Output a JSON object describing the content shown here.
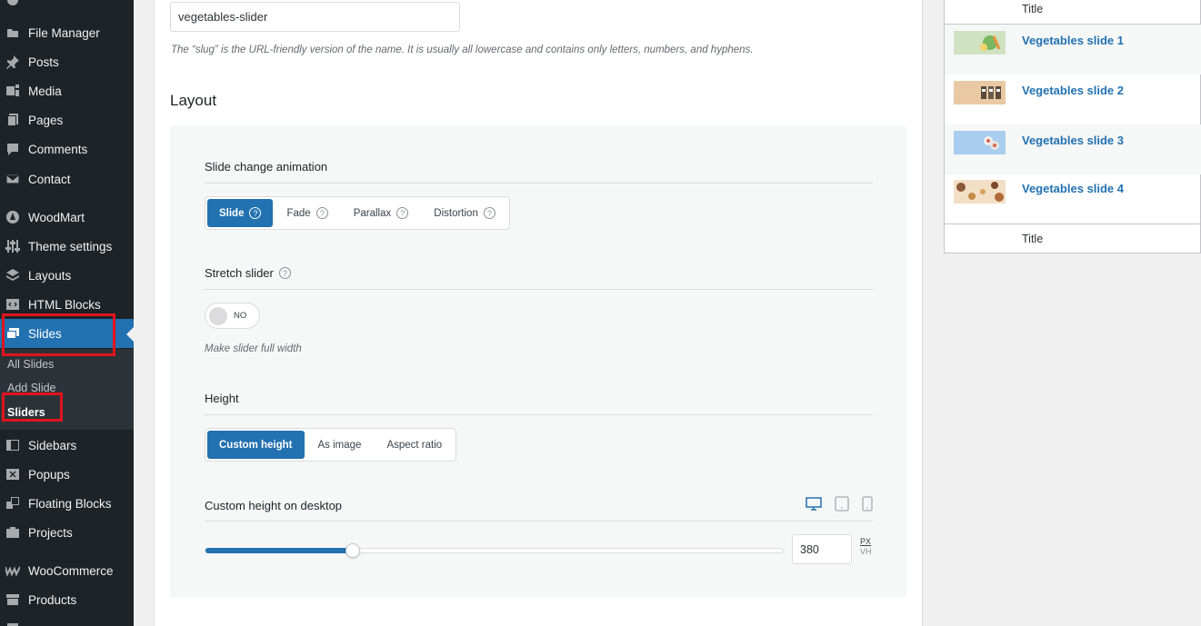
{
  "sidebar": {
    "items": [
      {
        "label": "File Manager",
        "icon": "file-manager-icon"
      },
      {
        "label": "Posts",
        "icon": "pin-icon"
      },
      {
        "label": "Media",
        "icon": "media-icon"
      },
      {
        "label": "Pages",
        "icon": "pages-icon"
      },
      {
        "label": "Comments",
        "icon": "comment-icon"
      },
      {
        "label": "Contact",
        "icon": "mail-icon"
      },
      {
        "label": "WoodMart",
        "icon": "woodmart-icon"
      },
      {
        "label": "Theme settings",
        "icon": "sliders-icon"
      },
      {
        "label": "Layouts",
        "icon": "layers-icon"
      },
      {
        "label": "HTML Blocks",
        "icon": "code-icon"
      },
      {
        "label": "Slides",
        "icon": "slides-icon"
      },
      {
        "label": "Sidebars",
        "icon": "sidebar-icon"
      },
      {
        "label": "Popups",
        "icon": "popup-icon"
      },
      {
        "label": "Floating Blocks",
        "icon": "blocks-icon"
      },
      {
        "label": "Projects",
        "icon": "briefcase-icon"
      },
      {
        "label": "WooCommerce",
        "icon": "woocommerce-icon"
      },
      {
        "label": "Products",
        "icon": "archive-icon"
      }
    ],
    "submenu": [
      "All Slides",
      "Add Slide",
      "Sliders"
    ]
  },
  "main": {
    "slug_value": "vegetables-slider",
    "slug_description": "The “slug” is the URL-friendly version of the name. It is usually all lowercase and contains only letters, numbers, and hyphens.",
    "layout_title": "Layout",
    "animation": {
      "label": "Slide change animation",
      "options": [
        "Slide",
        "Fade",
        "Parallax",
        "Distortion"
      ],
      "selected": "Slide"
    },
    "stretch": {
      "label": "Stretch slider",
      "toggle_label": "NO",
      "hint": "Make slider full width"
    },
    "height": {
      "label": "Height",
      "options": [
        "Custom height",
        "As image",
        "Aspect ratio"
      ],
      "selected": "Custom height"
    },
    "custom_height": {
      "label": "Custom height on desktop",
      "value": "380",
      "fraction": 0.255,
      "unit_px": "PX",
      "unit_vh": "VH"
    }
  },
  "right_panel": {
    "col_header": "Title",
    "col_footer": "Title",
    "rows": [
      {
        "title": "Vegetables slide 1"
      },
      {
        "title": "Vegetables slide 2"
      },
      {
        "title": "Vegetables slide 3"
      },
      {
        "title": "Vegetables slide 4"
      }
    ]
  },
  "colors": {
    "accent": "#2271b1",
    "highlight_box": "#e0141e",
    "sidebar_bg": "#1d2327"
  }
}
